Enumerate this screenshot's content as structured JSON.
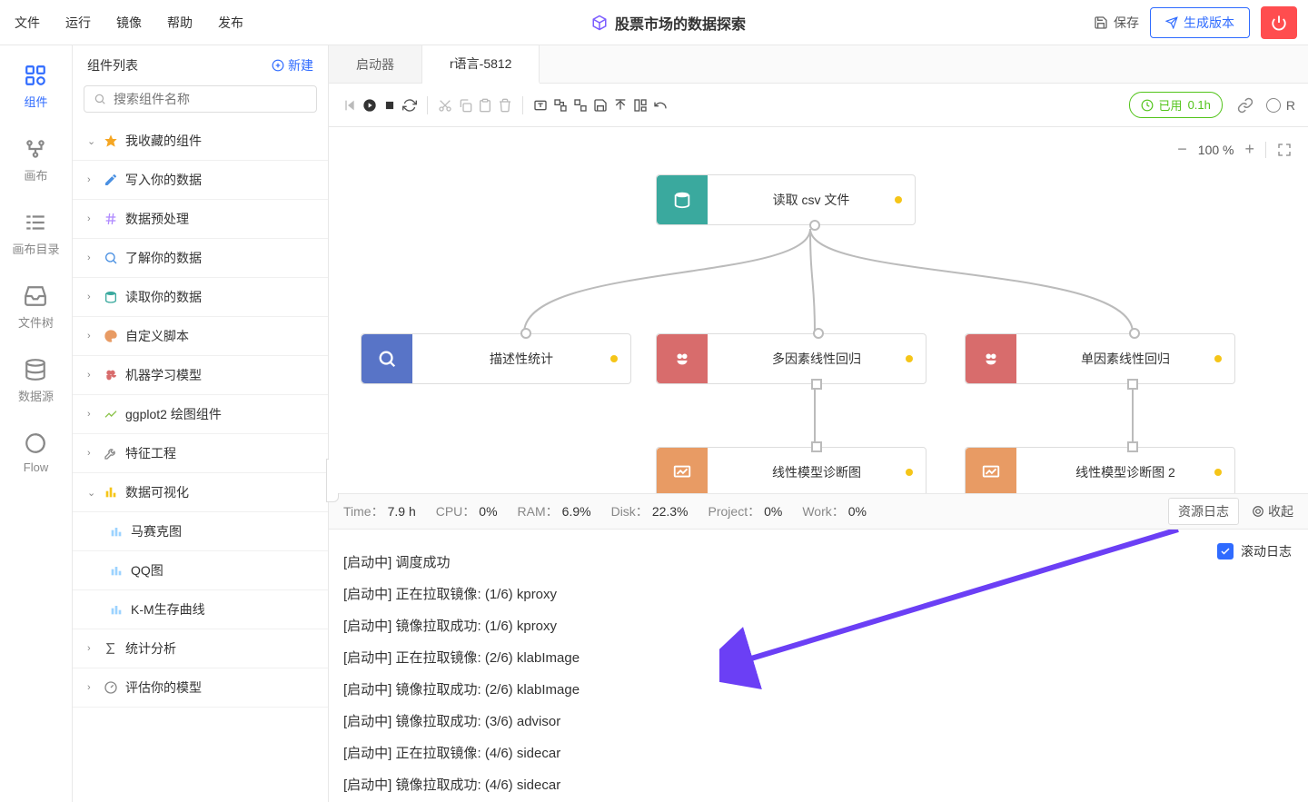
{
  "menu": [
    "文件",
    "运行",
    "镜像",
    "帮助",
    "发布"
  ],
  "title": "股票市场的数据探索",
  "top": {
    "save": "保存",
    "generate": "生成版本"
  },
  "rail": [
    {
      "id": "components",
      "label": "组件"
    },
    {
      "id": "canvas",
      "label": "画布"
    },
    {
      "id": "canvas-dir",
      "label": "画布目录"
    },
    {
      "id": "file-tree",
      "label": "文件树"
    },
    {
      "id": "data-source",
      "label": "数据源"
    },
    {
      "id": "flow",
      "label": "Flow"
    }
  ],
  "sidebar": {
    "title": "组件列表",
    "new": "新建",
    "search_placeholder": "搜索组件名称",
    "tree": [
      {
        "label": "我收藏的组件",
        "open": true,
        "icon": "star",
        "color": "#f5a623"
      },
      {
        "label": "写入你的数据",
        "open": false,
        "icon": "pencil",
        "color": "#4a90e2"
      },
      {
        "label": "数据预处理",
        "open": false,
        "icon": "hash",
        "color": "#b18cff"
      },
      {
        "label": "了解你的数据",
        "open": false,
        "icon": "search",
        "color": "#4a90e2"
      },
      {
        "label": "读取你的数据",
        "open": false,
        "icon": "db",
        "color": "#3aa99e"
      },
      {
        "label": "自定义脚本",
        "open": false,
        "icon": "palette",
        "color": "#e89b64"
      },
      {
        "label": "机器学习模型",
        "open": false,
        "icon": "brain",
        "color": "#d86c6c"
      },
      {
        "label": "ggplot2 绘图组件",
        "open": false,
        "icon": "chart",
        "color": "#8bc34a"
      },
      {
        "label": "特征工程",
        "open": false,
        "icon": "wrench",
        "color": "#888"
      },
      {
        "label": "数据可视化",
        "open": true,
        "icon": "bars",
        "color": "#f5c518"
      }
    ],
    "viz_children": [
      "马赛克图",
      "QQ图",
      "K-M生存曲线"
    ],
    "tree_tail": [
      {
        "label": "统计分析",
        "icon": "sigma",
        "color": "#666"
      },
      {
        "label": "评估你的模型",
        "icon": "gauge",
        "color": "#888"
      }
    ]
  },
  "tabs": [
    {
      "label": "启动器",
      "active": false
    },
    {
      "label": "r语言-5812",
      "active": true
    }
  ],
  "usage": {
    "label": "已用",
    "value": "0.1h"
  },
  "or_label": "R",
  "zoom": "100 %",
  "nodes": {
    "n1": "读取 csv 文件",
    "n2": "描述性统计",
    "n3": "多因素线性回归",
    "n4": "单因素线性回归",
    "n5": "线性模型诊断图",
    "n6": "线性模型诊断图 2"
  },
  "status": {
    "time_l": "Time：",
    "time_v": "7.9 h",
    "cpu_l": "CPU：",
    "cpu_v": "0%",
    "ram_l": "RAM：",
    "ram_v": "6.9%",
    "disk_l": "Disk：",
    "disk_v": "22.3%",
    "proj_l": "Project：",
    "proj_v": "0%",
    "work_l": "Work：",
    "work_v": "0%",
    "res_log": "资源日志",
    "collapse": "收起"
  },
  "scroll_log_label": "滚动日志",
  "logs": [
    "[启动中] 调度成功",
    "[启动中] 正在拉取镜像: (1/6) kproxy",
    "[启动中] 镜像拉取成功: (1/6) kproxy",
    "[启动中] 正在拉取镜像: (2/6) klabImage",
    "[启动中] 镜像拉取成功: (2/6) klabImage",
    "[启动中] 镜像拉取成功: (3/6) advisor",
    "[启动中] 正在拉取镜像: (4/6) sidecar",
    "[启动中] 镜像拉取成功: (4/6) sidecar"
  ]
}
